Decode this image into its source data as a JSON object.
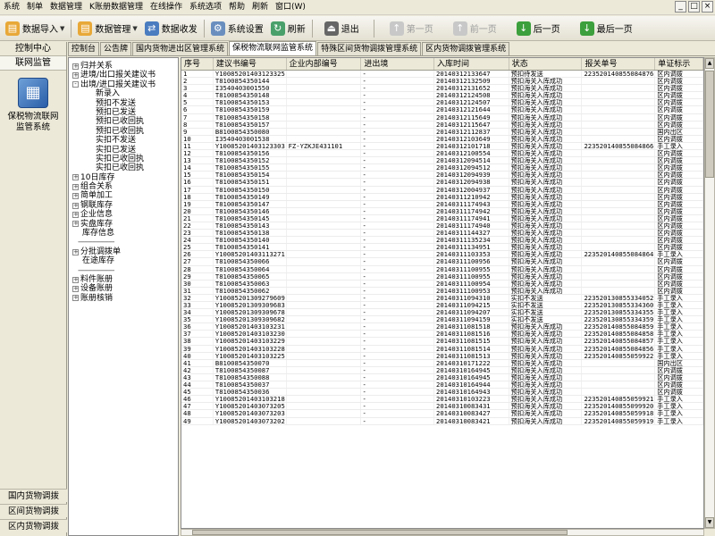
{
  "menu": [
    "系统",
    "制单",
    "数据管理",
    "K账册数据管理",
    "在线操作",
    "系统选项",
    "帮助",
    "刷新",
    "窗口(W)"
  ],
  "window_controls": [
    "_",
    "□",
    "×"
  ],
  "toolbar": {
    "import": "数据导入",
    "manage": "数据管理",
    "receive": "数据收发",
    "settings": "系统设置",
    "refresh": "刷新",
    "exit": "退出",
    "first": "第一页",
    "prev": "前一页",
    "next": "后一页",
    "last": "最后一页"
  },
  "left_panel": {
    "title": "控制中心",
    "subtitle": "联网监管",
    "module": "保税物流联网监管系统",
    "bottom": [
      "国内货物调拨",
      "区间货物调拨",
      "区内货物调拨"
    ]
  },
  "tabs": [
    "控制台",
    "公告牌",
    "国内货物进出区管理系统",
    "保税物流联网监管系统",
    "特殊区间货物调拨管理系统",
    "区内货物调拨管理系统"
  ],
  "active_tab": 3,
  "tree": [
    {
      "type": "node",
      "box": "+",
      "label": "归并关系"
    },
    {
      "type": "node",
      "box": "+",
      "label": "进境/出口报关建议书"
    },
    {
      "type": "node",
      "box": "-",
      "label": "出境/进口报关建议书"
    },
    {
      "type": "child",
      "label": "新录入"
    },
    {
      "type": "child",
      "label": "预扣不发送"
    },
    {
      "type": "child",
      "label": "预扣已发送"
    },
    {
      "type": "child",
      "label": "预扣已收回执"
    },
    {
      "type": "child",
      "label": "预扣已收回执"
    },
    {
      "type": "child",
      "label": "实扣不发送"
    },
    {
      "type": "child",
      "label": "实扣已发送"
    },
    {
      "type": "child",
      "label": "实扣已收回执"
    },
    {
      "type": "child",
      "label": "实扣已收回执"
    },
    {
      "type": "node",
      "box": "+",
      "label": "10日库存"
    },
    {
      "type": "node",
      "box": "+",
      "label": "组合关系"
    },
    {
      "type": "node",
      "box": "+",
      "label": "简单加工"
    },
    {
      "type": "node",
      "box": "+",
      "label": "钢联库存"
    },
    {
      "type": "node",
      "box": "+",
      "label": "企业信息"
    },
    {
      "type": "node",
      "box": "+",
      "label": "实盘库存"
    },
    {
      "type": "plain",
      "label": "库存信息"
    },
    {
      "type": "dash",
      "label": "------------------"
    },
    {
      "type": "node",
      "box": "+",
      "label": "分批调拨单"
    },
    {
      "type": "plain",
      "label": "在途库存"
    },
    {
      "type": "dash",
      "label": "------------------"
    },
    {
      "type": "node",
      "box": "+",
      "label": "料件账册"
    },
    {
      "type": "node",
      "box": "+",
      "label": "设备账册"
    },
    {
      "type": "node",
      "box": "+",
      "label": "账册核销"
    }
  ],
  "table": {
    "headers": [
      "序号",
      "建议书编号",
      "企业内部编号",
      "进出境",
      "入库时间",
      "状态",
      "报关单号",
      "单证标示"
    ],
    "rows": [
      [
        "1",
        "Y10085201403123325",
        "",
        "-",
        "20140312133647",
        "预扣待发送",
        "223520140855084876",
        "区内调拨"
      ],
      [
        "2",
        "T8100854350144",
        "",
        "-",
        "20140312132509",
        "预扣海关入库成功",
        "",
        "区内调拨"
      ],
      [
        "3",
        "I3540403001550",
        "",
        "-",
        "20140312131652",
        "预扣海关入库成功",
        "",
        "区内调拨"
      ],
      [
        "4",
        "T8100854350148",
        "",
        "-",
        "20140312124508",
        "预扣海关入库成功",
        "",
        "区内调拨"
      ],
      [
        "5",
        "T8100854350153",
        "",
        "-",
        "20140312124507",
        "预扣海关入库成功",
        "",
        "区内调拨"
      ],
      [
        "6",
        "T8100854350159",
        "",
        "-",
        "20140312121644",
        "预扣海关入库成功",
        "",
        "区内调拨"
      ],
      [
        "7",
        "T8100854350158",
        "",
        "-",
        "20140312115649",
        "预扣海关入库成功",
        "",
        "区内调拨"
      ],
      [
        "8",
        "T8100854350157",
        "",
        "-",
        "20140312115647",
        "预扣海关入库成功",
        "",
        "区内调拨"
      ],
      [
        "9",
        "B8100854350080",
        "",
        "-",
        "20140312112837",
        "预扣海关入库成功",
        "",
        "国内出区"
      ],
      [
        "10",
        "I3540403001538",
        "",
        "-",
        "20140312103649",
        "预扣海关入库成功",
        "",
        "区内调拨"
      ],
      [
        "11",
        "Y10085201403123303",
        "FZ-YZKJE431101",
        "-",
        "20140312101718",
        "预扣海关入库成功",
        "223520140855084866",
        "手工录入"
      ],
      [
        "12",
        "T8100854350156",
        "",
        "-",
        "20140312100554",
        "预扣海关入库成功",
        "",
        "区内调拨"
      ],
      [
        "13",
        "T8100854350152",
        "",
        "-",
        "20140312094514",
        "预扣海关入库成功",
        "",
        "区内调拨"
      ],
      [
        "14",
        "T8100854350155",
        "",
        "-",
        "20140312094512",
        "预扣海关入库成功",
        "",
        "区内调拨"
      ],
      [
        "15",
        "T8100854350154",
        "",
        "-",
        "20140312094939",
        "预扣海关入库成功",
        "",
        "区内调拨"
      ],
      [
        "16",
        "T8100854350151",
        "",
        "-",
        "20140312094938",
        "预扣海关入库成功",
        "",
        "区内调拨"
      ],
      [
        "17",
        "T8100854350150",
        "",
        "-",
        "20140312004937",
        "预扣海关入库成功",
        "",
        "区内调拨"
      ],
      [
        "18",
        "T8100854350149",
        "",
        "-",
        "20140311210942",
        "预扣海关入库成功",
        "",
        "区内调拨"
      ],
      [
        "19",
        "T8100854350147",
        "",
        "-",
        "20140311174943",
        "预扣海关入库成功",
        "",
        "区内调拨"
      ],
      [
        "20",
        "T8100854350146",
        "",
        "-",
        "20140311174942",
        "预扣海关入库成功",
        "",
        "区内调拨"
      ],
      [
        "21",
        "T8100854350145",
        "",
        "-",
        "20140311174941",
        "预扣海关入库成功",
        "",
        "区内调拨"
      ],
      [
        "22",
        "T8100854350143",
        "",
        "-",
        "20140311174940",
        "预扣海关入库成功",
        "",
        "区内调拨"
      ],
      [
        "23",
        "T8100854350138",
        "",
        "-",
        "20140311144327",
        "预扣海关入库成功",
        "",
        "区内调拨"
      ],
      [
        "24",
        "T8100854350140",
        "",
        "-",
        "20140311135234",
        "预扣海关入库成功",
        "",
        "区内调拨"
      ],
      [
        "25",
        "T8100854350141",
        "",
        "-",
        "20140311134951",
        "预扣海关入库成功",
        "",
        "区内调拨"
      ],
      [
        "26",
        "Y10085201403113271",
        "",
        "-",
        "20140311103353",
        "预扣海关入库成功",
        "223520140855084864",
        "手工录入"
      ],
      [
        "27",
        "T8100854350066",
        "",
        "-",
        "20140311100956",
        "预扣海关入库成功",
        "",
        "区内调拨"
      ],
      [
        "28",
        "T8100854350064",
        "",
        "-",
        "20140311100955",
        "预扣海关入库成功",
        "",
        "区内调拨"
      ],
      [
        "29",
        "T8100854350065",
        "",
        "-",
        "20140311100955",
        "预扣海关入库成功",
        "",
        "区内调拨"
      ],
      [
        "30",
        "T8100854350063",
        "",
        "-",
        "20140311100954",
        "预扣海关入库成功",
        "",
        "区内调拨"
      ],
      [
        "31",
        "T8100854350062",
        "",
        "-",
        "20140311100953",
        "预扣海关入库成功",
        "",
        "区内调拨"
      ],
      [
        "32",
        "Y10085201309279609",
        "",
        "-",
        "20140311094310",
        "实扣不发送",
        "223520130855334052",
        "手工录入"
      ],
      [
        "33",
        "Y10085201309309683",
        "",
        "-",
        "20140311094215",
        "实扣不发送",
        "223520130855334360",
        "手工录入"
      ],
      [
        "34",
        "Y10085201309309678",
        "",
        "-",
        "20140311094207",
        "实扣不发送",
        "223520130855334355",
        "手工录入"
      ],
      [
        "35",
        "Y10085201309309682",
        "",
        "-",
        "20140311094159",
        "实扣不发送",
        "223520130855334359",
        "手工录入"
      ],
      [
        "36",
        "Y10085201403103231",
        "",
        "-",
        "20140311081518",
        "预扣海关入库成功",
        "223520140855084859",
        "手工录入"
      ],
      [
        "37",
        "Y10085201403103230",
        "",
        "-",
        "20140311081516",
        "预扣海关入库成功",
        "223520140855084858",
        "手工录入"
      ],
      [
        "38",
        "Y10085201403103229",
        "",
        "-",
        "20140311081515",
        "预扣海关入库成功",
        "223520140855084857",
        "手工录入"
      ],
      [
        "39",
        "Y10085201403103228",
        "",
        "-",
        "20140311081514",
        "预扣海关入库成功",
        "223520140855084856",
        "手工录入"
      ],
      [
        "40",
        "Y10085201403103225",
        "",
        "-",
        "20140311081513",
        "预扣海关入库成功",
        "223520140855059922",
        "手工录入"
      ],
      [
        "41",
        "B8100854350070",
        "",
        "-",
        "20140310171222",
        "预扣海关入库成功",
        "",
        "国内出区"
      ],
      [
        "42",
        "T8100854350087",
        "",
        "-",
        "20140310164945",
        "预扣海关入库成功",
        "",
        "区内调拨"
      ],
      [
        "43",
        "T8100854350088",
        "",
        "-",
        "20140310164945",
        "预扣海关入库成功",
        "",
        "区内调拨"
      ],
      [
        "44",
        "T8100854350037",
        "",
        "-",
        "20140310164944",
        "预扣海关入库成功",
        "",
        "区内调拨"
      ],
      [
        "45",
        "T8100854350036",
        "",
        "-",
        "20140310164943",
        "预扣海关入库成功",
        "",
        "区内调拨"
      ],
      [
        "46",
        "Y10085201403103218",
        "",
        "-",
        "20140310103223",
        "预扣海关入库成功",
        "223520140855059921",
        "手工录入"
      ],
      [
        "47",
        "Y10085201403073205",
        "",
        "-",
        "20140310083431",
        "预扣海关入库成功",
        "223520140855099920",
        "手工录入"
      ],
      [
        "48",
        "Y10085201403073203",
        "",
        "-",
        "20140310083427",
        "预扣海关入库成功",
        "223520140855059918",
        "手工录入"
      ],
      [
        "49",
        "Y10085201403073202",
        "",
        "-",
        "20140310083421",
        "预扣海关入库成功",
        "223520140855059919",
        "手工录入"
      ]
    ]
  },
  "colors": {
    "window_bg": "#ece9d8",
    "grid_bg": "#ffffff",
    "active_tab": "#ffffff"
  }
}
